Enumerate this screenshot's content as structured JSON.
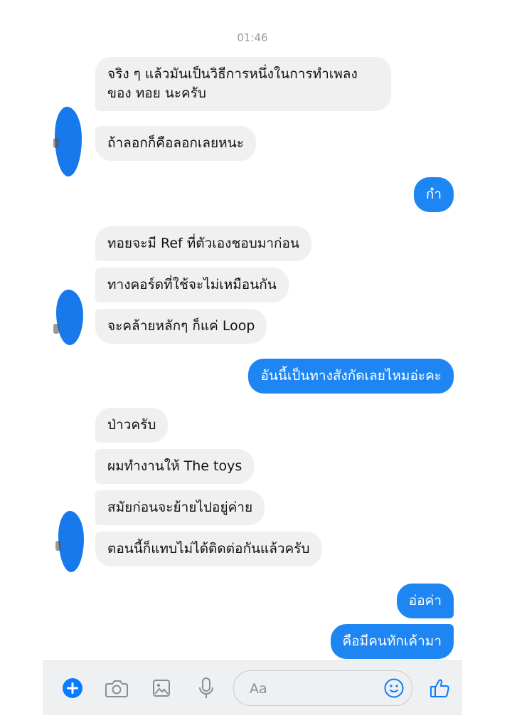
{
  "conversation": {
    "timestamp": "01:46",
    "messages": [
      {
        "side": "in",
        "text": "จริง ๆ แล้วมันเป็นวิธีการหนึ่งในการทำเพลงของ ทอย นะครับ"
      },
      {
        "side": "in",
        "text": "ถ้าลอกก็คือลอกเลยหนะ"
      },
      {
        "side": "out",
        "text": "กำ"
      },
      {
        "side": "in",
        "text": "ทอยจะมี Ref ที่ตัวเองชอบมาก่อน"
      },
      {
        "side": "in",
        "text": "ทางคอร์ดที่ใช้จะไม่เหมือนกัน"
      },
      {
        "side": "in",
        "text": "จะคล้ายหลักๆ ก็แค่ Loop"
      },
      {
        "side": "out",
        "text": "อันนี้เป็นทางสังกัดเลยไหมอ่ะคะ"
      },
      {
        "side": "in",
        "text": "ป่าวครับ"
      },
      {
        "side": "in",
        "text": "ผมทำงานให้ The toys"
      },
      {
        "side": "in",
        "text": "สมัยก่อนจะย้ายไปอยู่ค่าย"
      },
      {
        "side": "in",
        "text": "ตอนนี้ก็แทบไม่ได้ติดต่อกันแล้วครับ"
      },
      {
        "side": "out",
        "text": "อ่อค่า"
      },
      {
        "side": "out",
        "text": "คือมีคนทักเค้ามา"
      }
    ]
  },
  "composer": {
    "placeholder": "Aa",
    "icons": [
      "plus-icon",
      "camera-icon",
      "gallery-icon",
      "microphone-icon",
      "emoji-icon",
      "thumbs-up-icon"
    ]
  },
  "colors": {
    "outgoing_bubble": "#1d86f2",
    "incoming_bubble": "#f0f0f0",
    "avatar_scribble": "#1779ec",
    "accent": "#0a7cff"
  }
}
